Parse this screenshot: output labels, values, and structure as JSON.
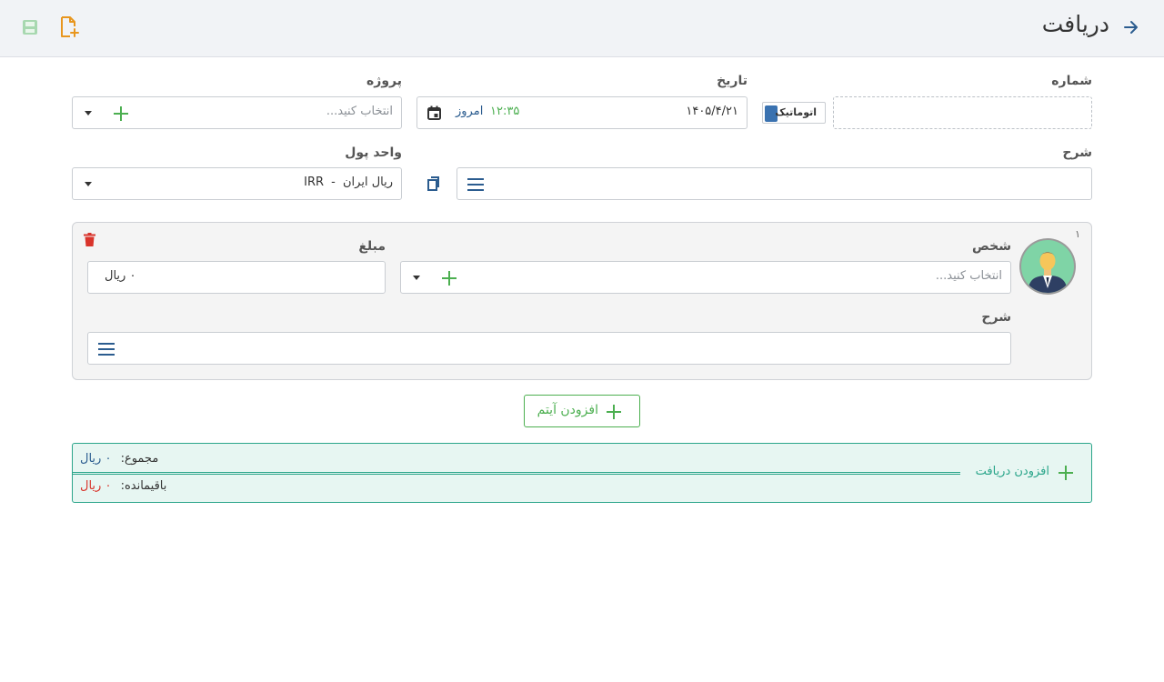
{
  "header": {
    "title": "دریافت"
  },
  "form": {
    "number_label": "شماره",
    "auto_label": "اتوماتیک",
    "date_label": "تاریخ",
    "date_value": "۱۴۰۵/۴/۲۱",
    "time_value": "۱۲:۳۵",
    "today_label": "امروز",
    "project_label": "پروژه",
    "project_placeholder": "انتخاب کنید...",
    "description_label": "شرح",
    "currency_label": "واحد پول",
    "currency_code": "IRR",
    "currency_separator": "-",
    "currency_name": "ریال ایران"
  },
  "item": {
    "index": "۱",
    "person_label": "شخص",
    "person_placeholder": "انتخاب کنید...",
    "amount_label": "مبلغ",
    "amount_value": "۰ ریال",
    "description_label": "شرح"
  },
  "actions": {
    "add_item": "افزودن آیتم",
    "add_receipt": "افزودن دریافت"
  },
  "summary": {
    "total_label": "مجموع:",
    "total_value": "۰ ریال",
    "remaining_label": "باقیمانده:",
    "remaining_value": "۰ ریال"
  },
  "colors": {
    "accent_blue": "#2b5c8f",
    "accent_green": "#4caf50",
    "delete_red": "#d9342b",
    "summary_teal": "#2aa58a",
    "warning_orange": "#e8961e"
  }
}
